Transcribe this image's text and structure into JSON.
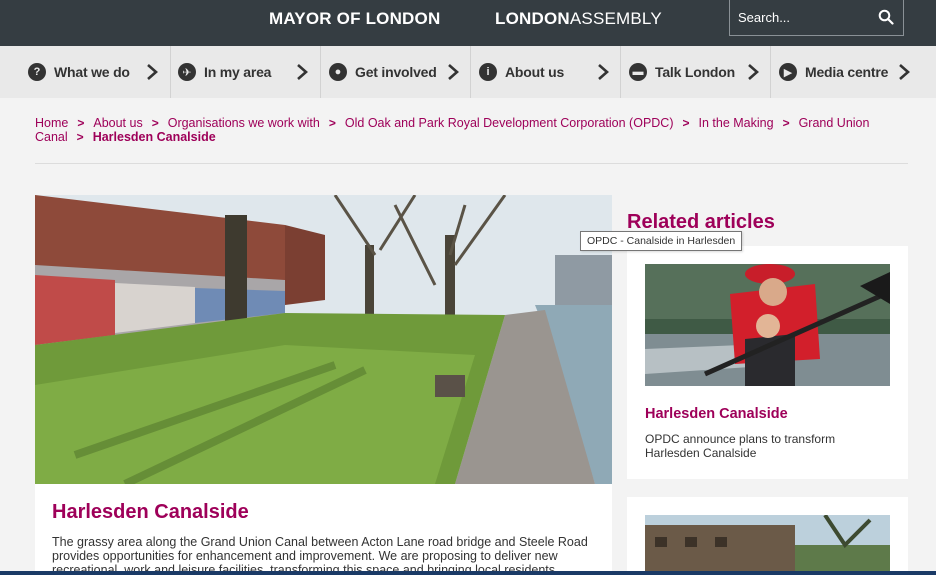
{
  "header": {
    "mayor_label": "MAYOR OF LONDON",
    "assembly_bold": "LONDON",
    "assembly_thin": "ASSEMBLY",
    "search_placeholder": "Search..."
  },
  "nav": {
    "items": [
      {
        "label": "What we do",
        "icon": "question-icon"
      },
      {
        "label": "In my area",
        "icon": "location-icon"
      },
      {
        "label": "Get involved",
        "icon": "pin-icon"
      },
      {
        "label": "About us",
        "icon": "info-icon"
      },
      {
        "label": "Talk London",
        "icon": "chat-icon"
      },
      {
        "label": "Media centre",
        "icon": "play-icon"
      }
    ]
  },
  "breadcrumb": {
    "items": [
      "Home",
      "About us",
      "Organisations we work with",
      "Old Oak and Park Royal Development Corporation (OPDC)",
      "In the Making",
      "Grand Union Canal"
    ],
    "current": "Harlesden Canalside"
  },
  "main": {
    "title": "Harlesden Canalside",
    "body": "The grassy area along the Grand Union Canal between Acton Lane road bridge and Steele Road provides opportunities for enhancement and improvement. We are proposing to deliver new recreational, work and leisure facilities, transforming this space and bringing local residents"
  },
  "tooltip": "OPDC - Canalside in Harlesden",
  "related": {
    "title": "Related articles",
    "cards": [
      {
        "title": "Harlesden Canalside",
        "desc": "OPDC announce plans to transform Harlesden Canalside"
      }
    ]
  }
}
